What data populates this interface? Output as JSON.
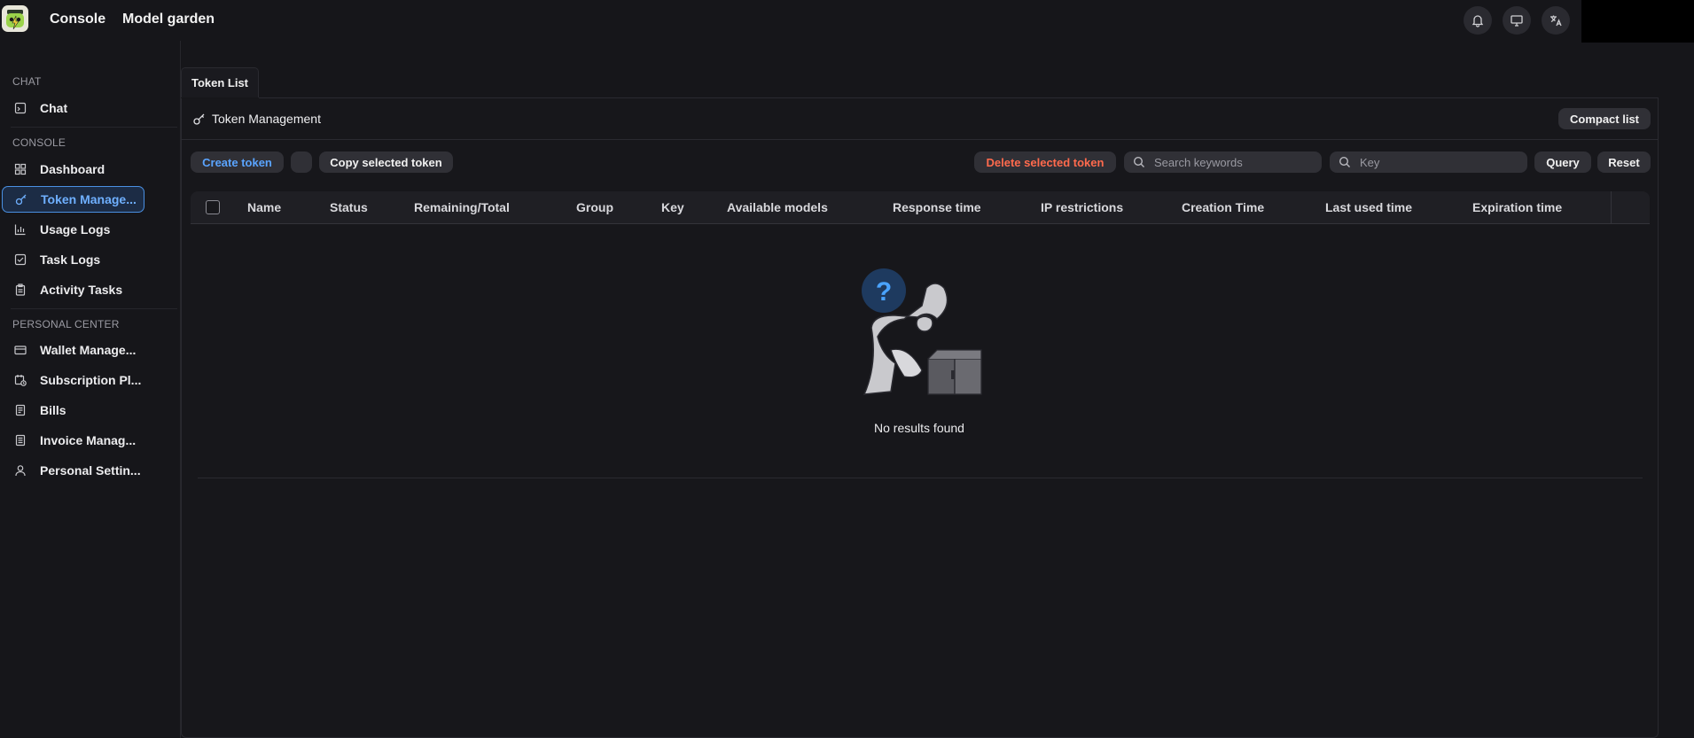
{
  "header": {
    "nav": [
      "Console",
      "Model garden"
    ]
  },
  "sidebar": {
    "sections": [
      "CHAT",
      "CONSOLE",
      "PERSONAL CENTER"
    ],
    "chat_items": [
      {
        "label": "Chat"
      }
    ],
    "console_items": [
      {
        "label": "Dashboard"
      },
      {
        "label": "Token Manage..."
      },
      {
        "label": "Usage Logs"
      },
      {
        "label": "Task Logs"
      },
      {
        "label": "Activity Tasks"
      }
    ],
    "personal_items": [
      {
        "label": "Wallet Manage..."
      },
      {
        "label": "Subscription Pl..."
      },
      {
        "label": "Bills"
      },
      {
        "label": "Invoice Manag..."
      },
      {
        "label": "Personal Settin..."
      }
    ]
  },
  "main": {
    "tab": "Token List",
    "panel_title": "Token Management",
    "compact_button": "Compact list",
    "toolbar": {
      "create": "Create token",
      "copy": "Copy selected token",
      "delete": "Delete selected token",
      "search_placeholder": "Search keywords",
      "key_placeholder": "Key",
      "query": "Query",
      "reset": "Reset"
    },
    "columns": [
      "Name",
      "Status",
      "Remaining/Total",
      "Group",
      "Key",
      "Available models",
      "Response time",
      "IP restrictions",
      "Creation Time",
      "Last used time",
      "Expiration time"
    ],
    "empty_text": "No results found"
  },
  "colors": {
    "background": "#16161a",
    "accent": "#4a90e2",
    "danger": "#ff6a4d"
  }
}
